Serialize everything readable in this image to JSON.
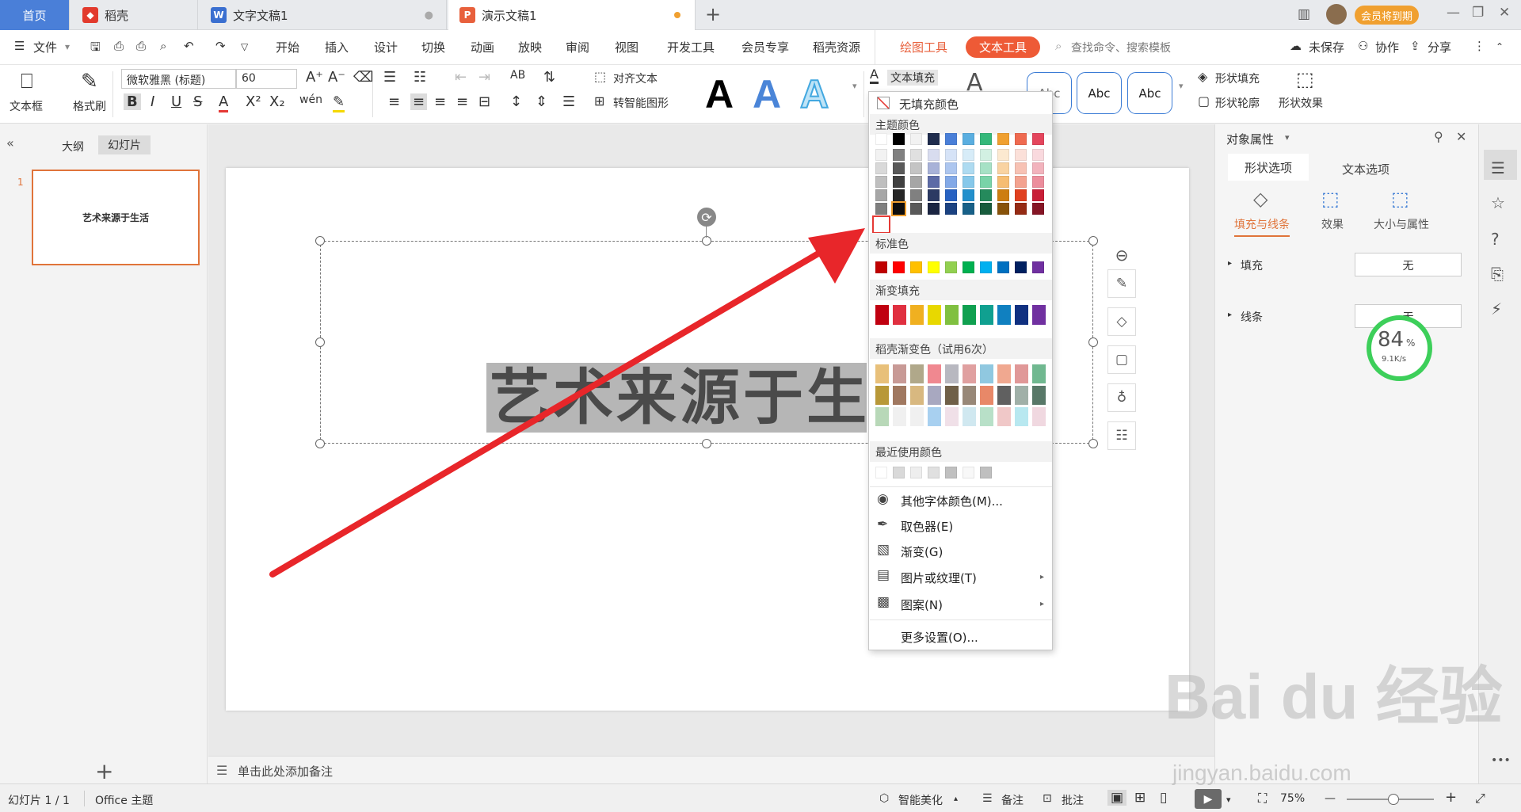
{
  "tabs": {
    "home": "首页",
    "daoke": "稻壳",
    "doc": "文字文稿1",
    "ppt": "演示文稿1",
    "vip_badge": "会员将到期"
  },
  "menu": {
    "file": "文件",
    "items": [
      "开始",
      "插入",
      "设计",
      "切换",
      "动画",
      "放映",
      "审阅",
      "视图",
      "开发工具",
      "会员专享",
      "稻壳资源"
    ],
    "draw_tool": "绘图工具",
    "text_tool": "文本工具",
    "search": "查找命令、搜索模板",
    "unsaved": "未保存",
    "collab": "协作",
    "share": "分享"
  },
  "ribbon": {
    "textbox": "文本框",
    "format_painter": "格式刷",
    "font_name": "微软雅黑 (标题)",
    "font_size": "60",
    "align_text": "对齐文本",
    "smartart": "转智能图形",
    "text_fill": "文本填充",
    "shape_fill": "形状填充",
    "shape_outline": "形状轮廓",
    "shape_effect": "形状效果",
    "style_letter": "A",
    "abc": [
      "Abc",
      "Abc",
      "Abc"
    ]
  },
  "leftpane": {
    "outline": "大纲",
    "slides": "幻灯片",
    "slide_num": "1",
    "thumb_text": "艺术来源于生活"
  },
  "slide": {
    "text": "艺术来源于生活",
    "notes": "单击此处添加备注"
  },
  "dropdown": {
    "no_fill": "无填充颜色",
    "theme_colors": "主题颜色",
    "standard_colors": "标准色",
    "gradient_fill": "渐变填充",
    "daoke_gradient": "稻壳渐变色（试用6次）",
    "recent_colors": "最近使用颜色",
    "items": [
      "其他字体颜色(M)...",
      "取色器(E)",
      "渐变(G)",
      "图片或纹理(T)",
      "图案(N)",
      "更多设置(O)..."
    ],
    "theme_top": [
      "#ffffff",
      "#000000",
      "#f2f2f2",
      "#1f2c4d",
      "#4a7fd8",
      "#5aaee0",
      "#35b87a",
      "#f0a030",
      "#ef6a50",
      "#e4465d"
    ],
    "theme_shades": [
      [
        "#f2f2f2",
        "#808080",
        "#e0e0e0",
        "#d8dcef",
        "#d6e3f7",
        "#d7ecf8",
        "#d2f0e2",
        "#fce9d0",
        "#fbe0d9",
        "#f9d9de"
      ],
      [
        "#d9d9d9",
        "#595959",
        "#c4c4c4",
        "#a8b2d8",
        "#adc6ef",
        "#aedbf1",
        "#a6e1c5",
        "#f9d3a2",
        "#f7c2b4",
        "#f2b3bd"
      ],
      [
        "#bfbfbf",
        "#404040",
        "#a6a6a6",
        "#5d6ba6",
        "#83a9e7",
        "#86c8ea",
        "#79d3a8",
        "#f6bd73",
        "#f3a28f",
        "#ec8d9c"
      ],
      [
        "#a6a6a6",
        "#262626",
        "#808080",
        "#2c3a63",
        "#2862c2",
        "#2390cc",
        "#258a5c",
        "#cd7d10",
        "#e0401f",
        "#c81f38"
      ],
      [
        "#7f7f7f",
        "#0d0d0d",
        "#595959",
        "#1b2542",
        "#1b4281",
        "#176088",
        "#185c3d",
        "#88530a",
        "#952b14",
        "#851525"
      ]
    ],
    "standard": [
      "#c00000",
      "#ff0000",
      "#ffc000",
      "#ffff00",
      "#92d050",
      "#00b050",
      "#00b0f0",
      "#0070c0",
      "#002060",
      "#7030a0"
    ],
    "gradients": [
      "#c00010",
      "#e03040",
      "#f0b020",
      "#e8d800",
      "#80c040",
      "#10a050",
      "#10a090",
      "#1080c0",
      "#103080",
      "#7030a0"
    ],
    "daoke_rows": [
      [
        "#e8c07a",
        "#c89a96",
        "#b0a88a",
        "#f08890",
        "#b8b8c0",
        "#e0a0a0",
        "#90c8e0",
        "#f0a890",
        "#e09898",
        "#70b890"
      ],
      [
        "#b89838",
        "#a07860",
        "#d8b880",
        "#a8a8c0",
        "#706048",
        "#988878",
        "#e88868",
        "#606060",
        "#a0b0a8",
        "#587868"
      ],
      [
        "#b8d8b8",
        "#f0f0f0",
        "#f0f0f0",
        "#a8d0f0",
        "#f0e0e8",
        "#d0e8f0",
        "#b8e0c8",
        "#f0c8c8",
        "#b8e8f0",
        "#f0d8e0"
      ]
    ],
    "recent": [
      "#ffffff",
      "#d9d9d9",
      "#eeeeee",
      "#e0e0e0",
      "#c0c0c0",
      "#f8f8f8",
      "#bfbfbf"
    ]
  },
  "rightpane": {
    "title": "对象属性",
    "tab_shape": "形状选项",
    "tab_text": "文本选项",
    "sub_fill_line": "填充与线条",
    "sub_effect": "效果",
    "sub_size": "大小与属性",
    "fill": "填充",
    "fill_value": "无",
    "line": "线条",
    "line_value": "无"
  },
  "gauge": {
    "percent": "84",
    "unit": "%",
    "speed": "9.1K/s"
  },
  "status": {
    "slide_info": "幻灯片 1 / 1",
    "theme": "Office 主题",
    "beautify": "智能美化",
    "notes": "备注",
    "comments": "批注",
    "zoom": "75%"
  },
  "watermark": {
    "big": "Bai du 经验",
    "url": "jingyan.baidu.com"
  }
}
